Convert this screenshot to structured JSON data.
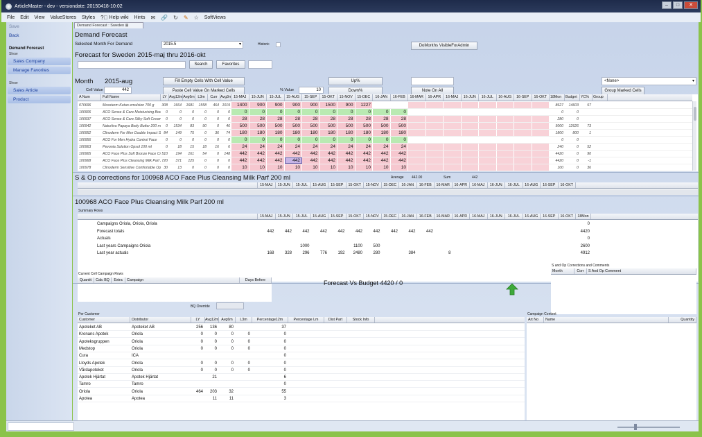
{
  "window": {
    "title": "ArticleMaster - dev - versiondate: 20150418-10:02"
  },
  "menu": [
    "File",
    "Edit",
    "View",
    "ValueStores",
    "Styles",
    "Help wiki",
    "Hints",
    "SoftViews"
  ],
  "sidebar": {
    "save": "Save",
    "back": "Back",
    "section1": "Demand Forecast",
    "show1": "Show",
    "sales_company": "Sales Company",
    "manage_favorites": "Manage Favorites",
    "show2": "Show",
    "sales_article": "Sales Article",
    "product": "Product"
  },
  "tab": {
    "label": "Demand Forecast : Sweden"
  },
  "header": {
    "title": "Demand Forecast",
    "selected_month_label": "Selected Month For Demand",
    "selected_month_value": "2015.5",
    "historic_label": "Historic",
    "domonths_button": "DoMonths VisibleForAdmin",
    "forecast_title": "Forecast for Sweden 2015-maj thru 2016-okt",
    "search_button": "Search",
    "favorites_button": "Favorites"
  },
  "controls": {
    "month_label": "Month",
    "month_value": "2015-aug",
    "cell_value_label": "Cell Value",
    "cell_value": "442",
    "fill_empty": "Fill Empty Cells With Cell Value",
    "paste_cell": "Paste Cell Value On Marked Cells",
    "pct_label": "% Value",
    "pct_value": "10",
    "up_btn": "Up%",
    "down_btn": "Down%",
    "note_btn": "Note On All",
    "none_select": "<None>",
    "group_btn": "Group Marked Cells"
  },
  "main_grid": {
    "left_cols": [
      "A Num",
      "Full Name",
      "LY",
      "Avg12m",
      "Avg6m",
      "L3m",
      "Curr",
      "Avg3m"
    ],
    "month_cols": [
      "15-MAJ",
      "15-JUN",
      "15-JUL",
      "15-AUG",
      "15-SEP",
      "15-OKT",
      "15-NOV",
      "15-DEC",
      "16-JAN",
      "16-FEB",
      "16-MAR",
      "16-APR",
      "16-MAJ",
      "16-JUN",
      "16-JUL",
      "16-AUG",
      "16-SEP",
      "16-OKT"
    ],
    "right_cols": [
      "18Mon",
      "Budget",
      "YC%",
      "Group"
    ],
    "rows": [
      {
        "anum": "070696",
        "name": "Mossterm Kutan emulsion 700 g",
        "left": [
          "308",
          "1664",
          "1681",
          "1558",
          "464",
          "1019"
        ],
        "months": [
          "1400",
          "900",
          "900",
          "900",
          "900",
          "1500",
          "900",
          "1227"
        ],
        "color": "pink",
        "right": [
          "8627",
          "14603",
          "57",
          ""
        ]
      },
      {
        "anum": "100906",
        "name": "ACO Sense & Care Moisturising Bodym",
        "left": [
          "0",
          "0",
          "0",
          "0",
          "0",
          "0"
        ],
        "months": [
          "0",
          "0",
          "0",
          "0",
          "0",
          "0",
          "0",
          "0",
          "0",
          "0"
        ],
        "color": "green",
        "right": [
          "0",
          "0",
          "",
          ""
        ]
      },
      {
        "anum": "100937",
        "name": "ACO Sense & Care Silky Soft Cream St",
        "left": [
          "0",
          "0",
          "0",
          "0",
          "0",
          "0"
        ],
        "months": [
          "28",
          "28",
          "28",
          "28",
          "28",
          "28",
          "28",
          "28",
          "28",
          "28"
        ],
        "color": "pink",
        "right": [
          "280",
          "0",
          "",
          ""
        ]
      },
      {
        "anum": "100942",
        "name": "Naturliva Papaya Body Butter 200 ml",
        "left": [
          "0",
          "1534",
          "83",
          "90",
          "0",
          "46"
        ],
        "months": [
          "500",
          "500",
          "500",
          "500",
          "500",
          "500",
          "500",
          "500",
          "500",
          "500"
        ],
        "color": "pink",
        "right": [
          "5000",
          "12626",
          "73",
          ""
        ]
      },
      {
        "anum": "100952",
        "name": "Clinoderm For Men Double Impact Sho",
        "left": [
          "84",
          "149",
          "75",
          "0",
          "36",
          "74"
        ],
        "months": [
          "180",
          "180",
          "180",
          "180",
          "180",
          "180",
          "180",
          "180",
          "180",
          "180"
        ],
        "color": "pink",
        "right": [
          "1800",
          "800",
          "1",
          ""
        ]
      },
      {
        "anum": "100956",
        "name": "ACO For Men Hydra Control Face",
        "left": [
          "0",
          "0",
          "0",
          "0",
          "0",
          "0"
        ],
        "months": [
          "0",
          "0",
          "0",
          "0",
          "0",
          "0",
          "0",
          "0",
          "0",
          "0"
        ],
        "color": "green",
        "right": [
          "0",
          "0",
          "",
          ""
        ]
      },
      {
        "anum": "100963",
        "name": "Pevonia Solution Opsol 100 ml",
        "left": [
          "0",
          "18",
          "15",
          "18",
          "16",
          "6"
        ],
        "months": [
          "24",
          "24",
          "24",
          "24",
          "24",
          "24",
          "24",
          "24",
          "24",
          "24"
        ],
        "color": "pink",
        "right": [
          "240",
          "0",
          "52",
          ""
        ]
      },
      {
        "anum": "100965",
        "name": "ACO Face Plus Soft Bronze Face Crem",
        "left": [
          "510",
          "194",
          "161",
          "54",
          "0",
          "148"
        ],
        "months": [
          "442",
          "442",
          "442",
          "442",
          "442",
          "442",
          "442",
          "442",
          "442",
          "442"
        ],
        "color": "pink",
        "right": [
          "4420",
          "0",
          "90",
          ""
        ]
      },
      {
        "anum": "100968",
        "name": "ACO Face Plus Cleansing Milk Parf 20(",
        "left": [
          "720",
          "371",
          "125",
          "0",
          "0",
          "0"
        ],
        "months": [
          "442",
          "442",
          "442",
          "442",
          "442",
          "442",
          "442",
          "442",
          "442",
          "442"
        ],
        "color": "pink",
        "right": [
          "4420",
          "0",
          "-1",
          ""
        ]
      },
      {
        "anum": "100978",
        "name": "Clinoderm Sensitive Comfortable Opo",
        "left": [
          "30",
          "13",
          "0",
          "0",
          "0",
          "0"
        ],
        "months": [
          "10",
          "10",
          "10",
          "10",
          "10",
          "10",
          "10",
          "10",
          "10",
          "10"
        ],
        "color": "pink",
        "right": [
          "100",
          "0",
          "36",
          ""
        ]
      }
    ]
  },
  "sop": {
    "title": "S & Op corrections for 100968 ACO Face Plus Cleansing Milk Parf 200 ml",
    "average_label": "Average",
    "average_value": "442.00",
    "sum_label": "Sum",
    "sum_value": "442"
  },
  "summary": {
    "title": "100968 ACO Face Plus Cleansing Milk Parf 200 ml",
    "rows_label": "Summary Rows",
    "rows": [
      {
        "label": "Campaigns  Oriola, Oriola, Oriola",
        "values": [
          "",
          "",
          "",
          "",
          "",
          "",
          "",
          "",
          "",
          "",
          "",
          "",
          "",
          "",
          "",
          "",
          "",
          ""
        ],
        "total": "0"
      },
      {
        "label": "Forecast totals",
        "values": [
          "442",
          "442",
          "442",
          "442",
          "442",
          "442",
          "442",
          "442",
          "442",
          "442",
          "",
          "",
          "",
          "",
          "",
          "",
          "",
          ""
        ],
        "total": "4420"
      },
      {
        "label": "Actuals",
        "values": [
          "",
          "",
          "",
          "",
          "",
          "",
          "",
          "",
          "",
          "",
          "",
          "",
          "",
          "",
          "",
          "",
          "",
          ""
        ],
        "total": "0"
      },
      {
        "label": "Last years Campaigns  Oriola",
        "values": [
          "",
          "",
          "1000",
          "",
          "",
          "1100",
          "500",
          "",
          "",
          "",
          "",
          "",
          "",
          "",
          "",
          "",
          "",
          ""
        ],
        "total": "2600"
      },
      {
        "label": "Last year actuals",
        "values": [
          "168",
          "328",
          "296",
          "776",
          "192",
          "2480",
          "280",
          "",
          "384",
          "",
          "8",
          "",
          "",
          "",
          "",
          "",
          "",
          ""
        ],
        "total": "4912"
      }
    ]
  },
  "bottom": {
    "campaign_rows_label": "Current Cell Campaign Rows",
    "campaign_cols": [
      "Quantit",
      "Calc BQ",
      "Extra",
      "Campaign",
      "Days Before"
    ],
    "bq_override": "BQ Override",
    "forecast_vs_budget": "Forecast Vs Budget   4420 / 0",
    "sop_comments_label": "S and Op Corrections and Comments",
    "sop_cols": [
      "Month",
      "Corr",
      "S And Op Comment"
    ]
  },
  "customers": {
    "label": "Per Customer",
    "cols": [
      "Customer",
      "Distributor",
      "LY",
      "Avg12m",
      "Avg6m",
      "L3m",
      "Percentage12m",
      "Percentage Lm",
      "Dist Part",
      "Stock Info"
    ],
    "rows": [
      [
        "Apoteket AB",
        "Apoteket AB",
        "256",
        "136",
        "80",
        "",
        "37"
      ],
      [
        "Kronans Apotek",
        "Oriola",
        "0",
        "0",
        "0",
        "0",
        "0"
      ],
      [
        "Apoteksgruppen",
        "Oriola",
        "0",
        "0",
        "0",
        "0",
        "0"
      ],
      [
        "Medstop",
        "Oriola",
        "0",
        "0",
        "0",
        "0",
        "0"
      ],
      [
        "Cura",
        "ICA",
        "",
        "",
        "",
        "",
        "0"
      ],
      [
        "Lloyds Apotek",
        "Oriola",
        "0",
        "0",
        "0",
        "0",
        "0"
      ],
      [
        "Vårdapoteket",
        "Oriola",
        "0",
        "0",
        "0",
        "0",
        "0"
      ],
      [
        "Apotek Hjärtat",
        "Apotek Hjärtat",
        "",
        "21",
        "",
        "",
        "6"
      ],
      [
        "Tamro",
        "Tamro",
        "",
        "",
        "",
        "",
        "0"
      ],
      [
        "Oriola",
        "Oriola",
        "464",
        "203",
        "32",
        "",
        "55"
      ],
      [
        "Apotea",
        "Apotea",
        "",
        "11",
        "11",
        "",
        "3"
      ]
    ]
  },
  "campaign_content": {
    "label": "Campaign Content",
    "cols": [
      "Art No",
      "Name",
      "Quantity"
    ]
  },
  "colors": {
    "pink": "#f6c7cf",
    "green": "#b9eab2",
    "accent": "#1c3f9c"
  }
}
